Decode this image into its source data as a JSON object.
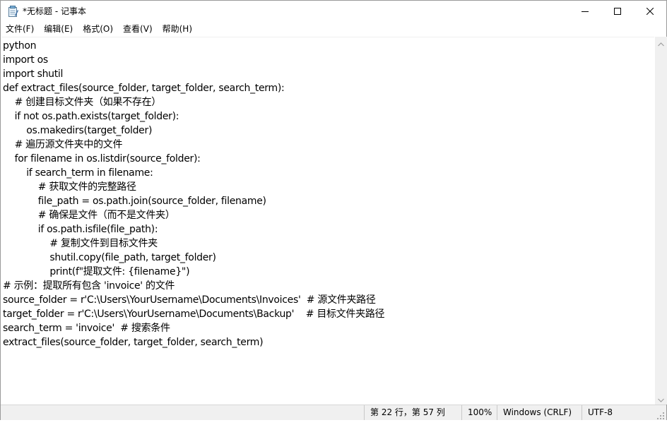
{
  "window": {
    "title": "*无标题 - 记事本",
    "minimize_icon": "minimize-icon",
    "maximize_icon": "maximize-icon",
    "close_icon": "close-icon"
  },
  "menu": {
    "items": [
      "文件(F)",
      "编辑(E)",
      "格式(O)",
      "查看(V)",
      "帮助(H)"
    ]
  },
  "editor": {
    "lines": [
      "python",
      "import os",
      "import shutil",
      "def extract_files(source_folder, target_folder, search_term):",
      "    # 创建目标文件夹（如果不存在）",
      "    if not os.path.exists(target_folder):",
      "        os.makedirs(target_folder)",
      "    # 遍历源文件夹中的文件",
      "    for filename in os.listdir(source_folder):",
      "        if search_term in filename:",
      "            # 获取文件的完整路径",
      "            file_path = os.path.join(source_folder, filename)",
      "            # 确保是文件（而不是文件夹）",
      "            if os.path.isfile(file_path):",
      "                # 复制文件到目标文件夹",
      "                shutil.copy(file_path, target_folder)",
      "                print(f\"提取文件: {filename}\")",
      "# 示例：提取所有包含 'invoice' 的文件",
      "source_folder = r'C:\\Users\\YourUsername\\Documents\\Invoices'  # 源文件夹路径",
      "target_folder = r'C:\\Users\\YourUsername\\Documents\\Backup'    # 目标文件夹路径",
      "search_term = 'invoice'  # 搜索条件",
      "extract_files(source_folder, target_folder, search_term)"
    ]
  },
  "statusbar": {
    "position": "第 22 行，第 57 列",
    "zoom": "100%",
    "line_ending": "Windows (CRLF)",
    "encoding": "UTF-8"
  }
}
